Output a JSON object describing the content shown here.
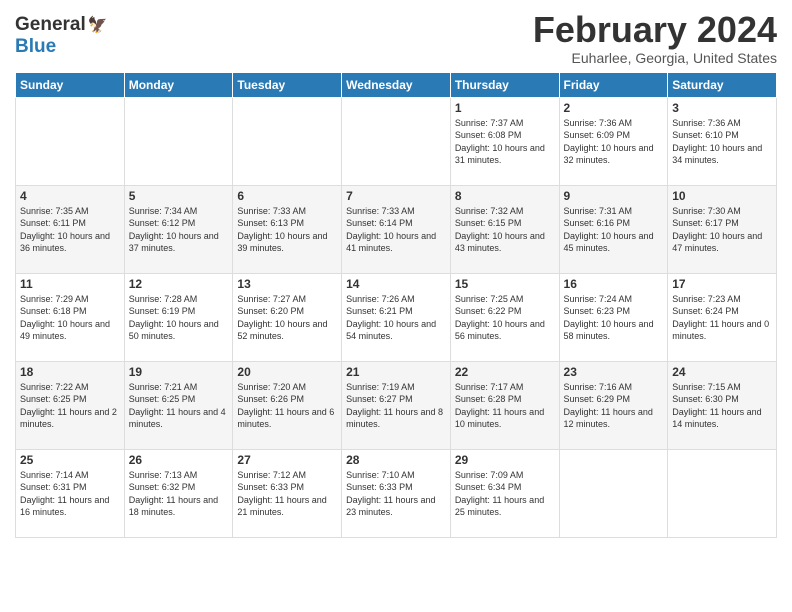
{
  "header": {
    "logo_general": "General",
    "logo_blue": "Blue",
    "title": "February 2024",
    "subtitle": "Euharlee, Georgia, United States"
  },
  "days_of_week": [
    "Sunday",
    "Monday",
    "Tuesday",
    "Wednesday",
    "Thursday",
    "Friday",
    "Saturday"
  ],
  "weeks": [
    [
      {
        "day": "",
        "sunrise": "",
        "sunset": "",
        "daylight": ""
      },
      {
        "day": "",
        "sunrise": "",
        "sunset": "",
        "daylight": ""
      },
      {
        "day": "",
        "sunrise": "",
        "sunset": "",
        "daylight": ""
      },
      {
        "day": "",
        "sunrise": "",
        "sunset": "",
        "daylight": ""
      },
      {
        "day": "1",
        "sunrise": "Sunrise: 7:37 AM",
        "sunset": "Sunset: 6:08 PM",
        "daylight": "Daylight: 10 hours and 31 minutes."
      },
      {
        "day": "2",
        "sunrise": "Sunrise: 7:36 AM",
        "sunset": "Sunset: 6:09 PM",
        "daylight": "Daylight: 10 hours and 32 minutes."
      },
      {
        "day": "3",
        "sunrise": "Sunrise: 7:36 AM",
        "sunset": "Sunset: 6:10 PM",
        "daylight": "Daylight: 10 hours and 34 minutes."
      }
    ],
    [
      {
        "day": "4",
        "sunrise": "Sunrise: 7:35 AM",
        "sunset": "Sunset: 6:11 PM",
        "daylight": "Daylight: 10 hours and 36 minutes."
      },
      {
        "day": "5",
        "sunrise": "Sunrise: 7:34 AM",
        "sunset": "Sunset: 6:12 PM",
        "daylight": "Daylight: 10 hours and 37 minutes."
      },
      {
        "day": "6",
        "sunrise": "Sunrise: 7:33 AM",
        "sunset": "Sunset: 6:13 PM",
        "daylight": "Daylight: 10 hours and 39 minutes."
      },
      {
        "day": "7",
        "sunrise": "Sunrise: 7:33 AM",
        "sunset": "Sunset: 6:14 PM",
        "daylight": "Daylight: 10 hours and 41 minutes."
      },
      {
        "day": "8",
        "sunrise": "Sunrise: 7:32 AM",
        "sunset": "Sunset: 6:15 PM",
        "daylight": "Daylight: 10 hours and 43 minutes."
      },
      {
        "day": "9",
        "sunrise": "Sunrise: 7:31 AM",
        "sunset": "Sunset: 6:16 PM",
        "daylight": "Daylight: 10 hours and 45 minutes."
      },
      {
        "day": "10",
        "sunrise": "Sunrise: 7:30 AM",
        "sunset": "Sunset: 6:17 PM",
        "daylight": "Daylight: 10 hours and 47 minutes."
      }
    ],
    [
      {
        "day": "11",
        "sunrise": "Sunrise: 7:29 AM",
        "sunset": "Sunset: 6:18 PM",
        "daylight": "Daylight: 10 hours and 49 minutes."
      },
      {
        "day": "12",
        "sunrise": "Sunrise: 7:28 AM",
        "sunset": "Sunset: 6:19 PM",
        "daylight": "Daylight: 10 hours and 50 minutes."
      },
      {
        "day": "13",
        "sunrise": "Sunrise: 7:27 AM",
        "sunset": "Sunset: 6:20 PM",
        "daylight": "Daylight: 10 hours and 52 minutes."
      },
      {
        "day": "14",
        "sunrise": "Sunrise: 7:26 AM",
        "sunset": "Sunset: 6:21 PM",
        "daylight": "Daylight: 10 hours and 54 minutes."
      },
      {
        "day": "15",
        "sunrise": "Sunrise: 7:25 AM",
        "sunset": "Sunset: 6:22 PM",
        "daylight": "Daylight: 10 hours and 56 minutes."
      },
      {
        "day": "16",
        "sunrise": "Sunrise: 7:24 AM",
        "sunset": "Sunset: 6:23 PM",
        "daylight": "Daylight: 10 hours and 58 minutes."
      },
      {
        "day": "17",
        "sunrise": "Sunrise: 7:23 AM",
        "sunset": "Sunset: 6:24 PM",
        "daylight": "Daylight: 11 hours and 0 minutes."
      }
    ],
    [
      {
        "day": "18",
        "sunrise": "Sunrise: 7:22 AM",
        "sunset": "Sunset: 6:25 PM",
        "daylight": "Daylight: 11 hours and 2 minutes."
      },
      {
        "day": "19",
        "sunrise": "Sunrise: 7:21 AM",
        "sunset": "Sunset: 6:25 PM",
        "daylight": "Daylight: 11 hours and 4 minutes."
      },
      {
        "day": "20",
        "sunrise": "Sunrise: 7:20 AM",
        "sunset": "Sunset: 6:26 PM",
        "daylight": "Daylight: 11 hours and 6 minutes."
      },
      {
        "day": "21",
        "sunrise": "Sunrise: 7:19 AM",
        "sunset": "Sunset: 6:27 PM",
        "daylight": "Daylight: 11 hours and 8 minutes."
      },
      {
        "day": "22",
        "sunrise": "Sunrise: 7:17 AM",
        "sunset": "Sunset: 6:28 PM",
        "daylight": "Daylight: 11 hours and 10 minutes."
      },
      {
        "day": "23",
        "sunrise": "Sunrise: 7:16 AM",
        "sunset": "Sunset: 6:29 PM",
        "daylight": "Daylight: 11 hours and 12 minutes."
      },
      {
        "day": "24",
        "sunrise": "Sunrise: 7:15 AM",
        "sunset": "Sunset: 6:30 PM",
        "daylight": "Daylight: 11 hours and 14 minutes."
      }
    ],
    [
      {
        "day": "25",
        "sunrise": "Sunrise: 7:14 AM",
        "sunset": "Sunset: 6:31 PM",
        "daylight": "Daylight: 11 hours and 16 minutes."
      },
      {
        "day": "26",
        "sunrise": "Sunrise: 7:13 AM",
        "sunset": "Sunset: 6:32 PM",
        "daylight": "Daylight: 11 hours and 18 minutes."
      },
      {
        "day": "27",
        "sunrise": "Sunrise: 7:12 AM",
        "sunset": "Sunset: 6:33 PM",
        "daylight": "Daylight: 11 hours and 21 minutes."
      },
      {
        "day": "28",
        "sunrise": "Sunrise: 7:10 AM",
        "sunset": "Sunset: 6:33 PM",
        "daylight": "Daylight: 11 hours and 23 minutes."
      },
      {
        "day": "29",
        "sunrise": "Sunrise: 7:09 AM",
        "sunset": "Sunset: 6:34 PM",
        "daylight": "Daylight: 11 hours and 25 minutes."
      },
      {
        "day": "",
        "sunrise": "",
        "sunset": "",
        "daylight": ""
      },
      {
        "day": "",
        "sunrise": "",
        "sunset": "",
        "daylight": ""
      }
    ]
  ]
}
